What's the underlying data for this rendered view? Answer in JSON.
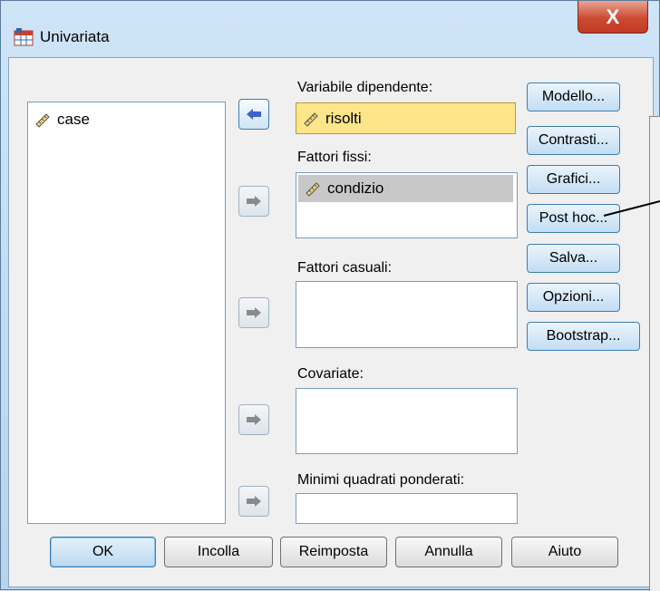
{
  "window": {
    "title": "Univariata",
    "close_label": "X"
  },
  "source_list": {
    "items": [
      {
        "label": "case",
        "icon": "ruler-scale-icon"
      }
    ]
  },
  "targets": {
    "dependent": {
      "label": "Variabile dipendente:",
      "value": "risolti"
    },
    "fixed": {
      "label": "Fattori fissi:",
      "items": [
        "condizio"
      ]
    },
    "random": {
      "label": "Fattori casuali:",
      "items": []
    },
    "covariates": {
      "label": "Covariate:",
      "items": []
    },
    "wls": {
      "label": "Minimi quadrati ponderati:",
      "value": ""
    }
  },
  "side_buttons": {
    "modello": "Modello...",
    "contrasti": "Contrasti...",
    "grafici": "Grafici...",
    "posthoc": "Post hoc...",
    "salva": "Salva...",
    "opzioni": "Opzioni...",
    "bootstrap": "Bootstrap..."
  },
  "bottom_buttons": {
    "ok": "OK",
    "incolla": "Incolla",
    "reimposta": "Reimposta",
    "annulla": "Annulla",
    "aiuto": "Aiuto"
  },
  "colors": {
    "selection_fill": "#fde58a",
    "selection_border": "#b89b34",
    "item_highlight": "#c8c8c8",
    "accent": "#3c7fb1"
  }
}
